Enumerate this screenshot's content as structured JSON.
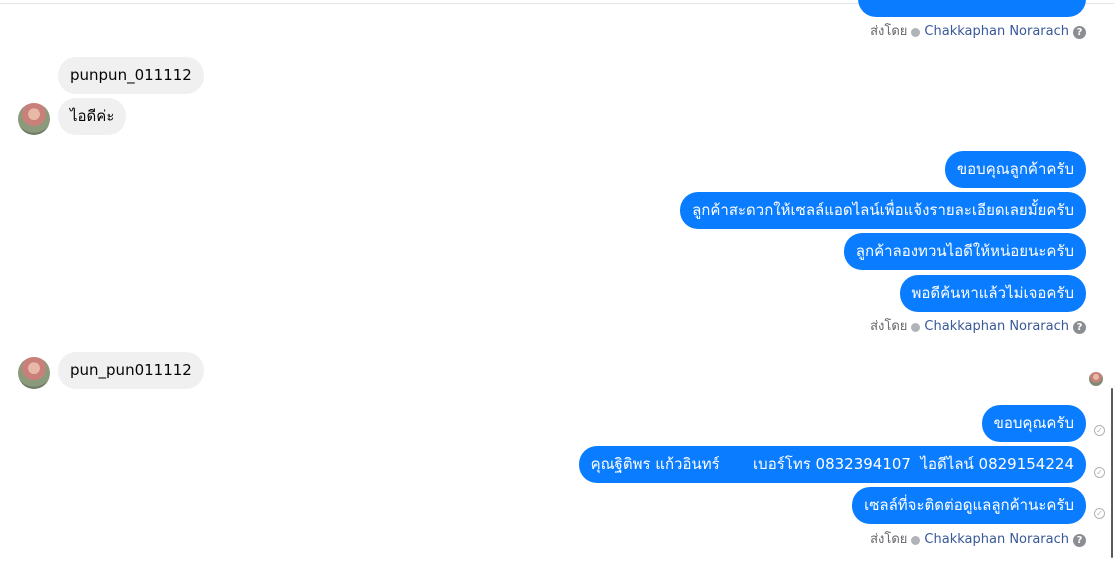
{
  "sent_by_label": "ส่งโดย",
  "agent_name": "Chakkaphan Norarach",
  "help_glyph": "?",
  "check_glyph": "✓",
  "icons": {
    "verified": "verified-badge-icon",
    "help": "help-question-icon",
    "seen": "check-circle-icon"
  },
  "colors": {
    "outgoing_bubble": "#0a7cff",
    "incoming_bubble": "#f0f0f0",
    "agent_name": "#385898"
  },
  "messages": {
    "group1": {
      "in1": "punpun_011112",
      "in2": "ไอดีค่ะ"
    },
    "group2": {
      "out1": "ขอบคุณลูกค้าครับ",
      "out2": "ลูกค้าสะดวกให้เซลล์แอดไลน์เพื่อแจ้งรายละเอียดเลยมั้ยครับ",
      "out3": "ลูกค้าลองทวนไอดีให้หน่อยนะครับ",
      "out4": "พอดีค้นหาแล้วไม่เจอครับ"
    },
    "group3": {
      "in1": "pun_pun011112"
    },
    "group4": {
      "out1": "ขอบคุณครับ",
      "out2": "คุณฐิติพร แก้วอินทร์       เบอร์โทร 0832394107  ไอดีไลน์ 0829154224",
      "out3": "เซลล์ที่จะติดต่อดูแลลูกค้านะครับ"
    }
  }
}
